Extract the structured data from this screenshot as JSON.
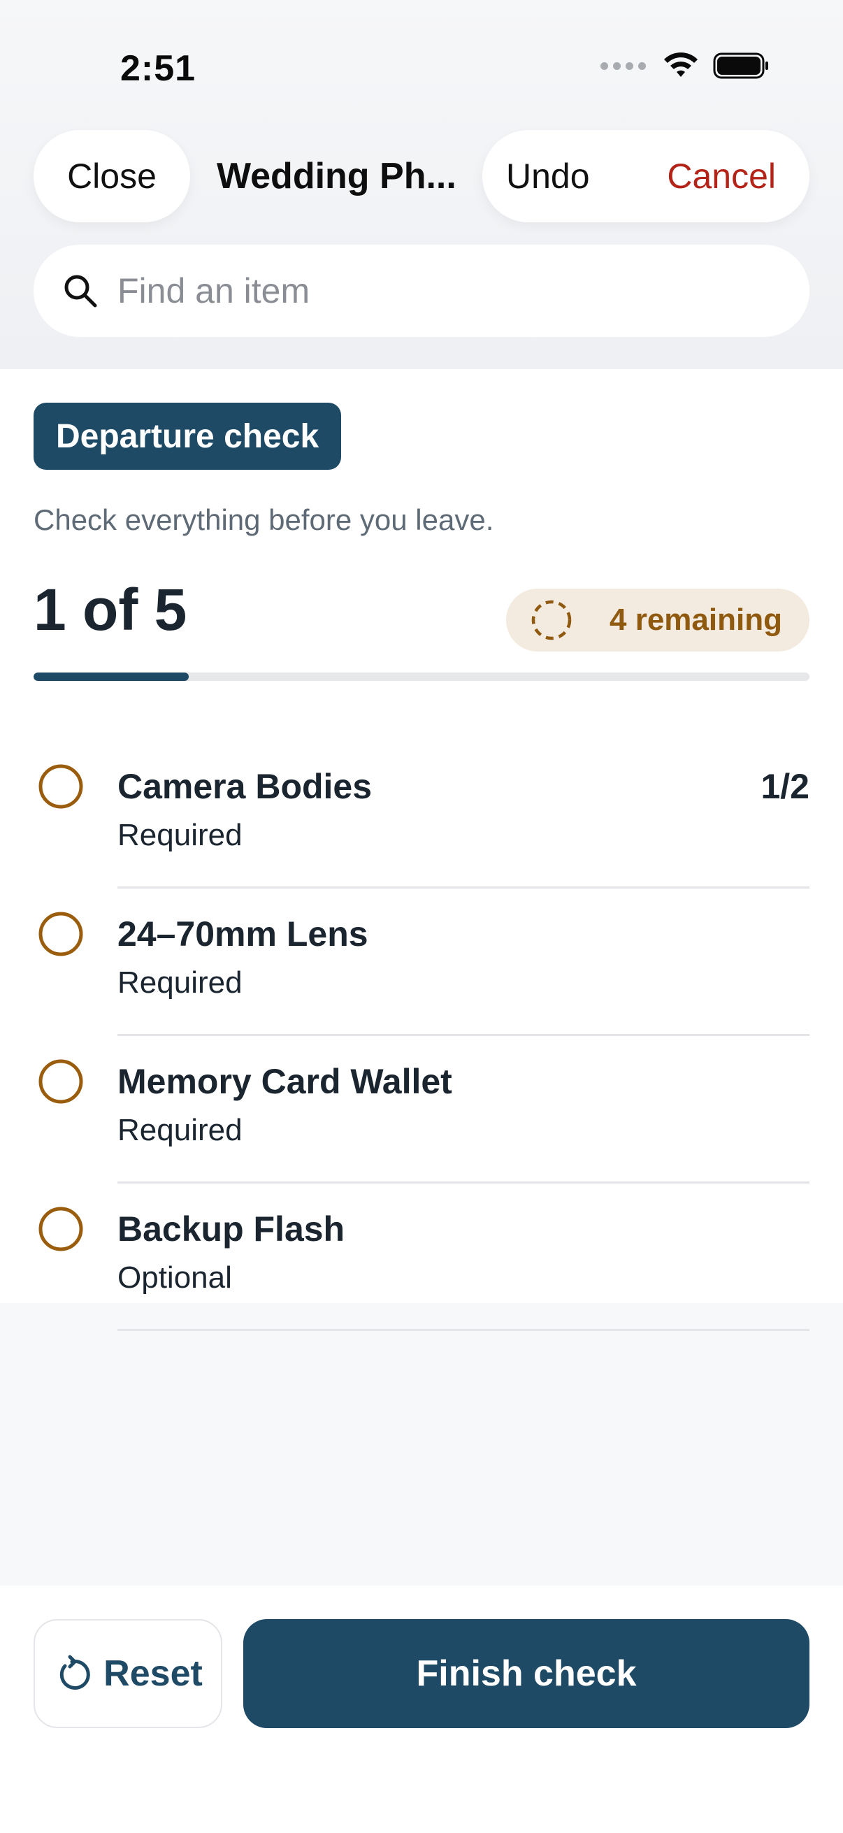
{
  "status_bar": {
    "time": "2:51"
  },
  "nav": {
    "close_label": "Close",
    "title": "Wedding Ph...",
    "undo_label": "Undo",
    "cancel_label": "Cancel"
  },
  "search": {
    "placeholder": "Find an item",
    "value": ""
  },
  "check": {
    "badge": "Departure check",
    "subtitle": "Check everything before you leave.",
    "progress_text": "1 of 5",
    "progress_fraction": 0.2,
    "remaining_label": "4 remaining"
  },
  "items": [
    {
      "name": "Camera Bodies",
      "requirement": "Required",
      "count": "1/2"
    },
    {
      "name": "24–70mm Lens",
      "requirement": "Required",
      "count": ""
    },
    {
      "name": "Memory Card Wallet",
      "requirement": "Required",
      "count": ""
    },
    {
      "name": "Backup Flash",
      "requirement": "Optional",
      "count": ""
    }
  ],
  "actions": {
    "reset_label": "Reset",
    "finish_label": "Finish check"
  },
  "colors": {
    "accent": "#1e4a66",
    "warning": "#8f5a0f",
    "warning_bg": "#f4ebe0",
    "cancel": "#b32317"
  },
  "icons": {
    "search": "search-icon",
    "item_status": "circle-outline-icon",
    "remaining": "dashed-circle-icon",
    "reset": "reset-icon"
  }
}
